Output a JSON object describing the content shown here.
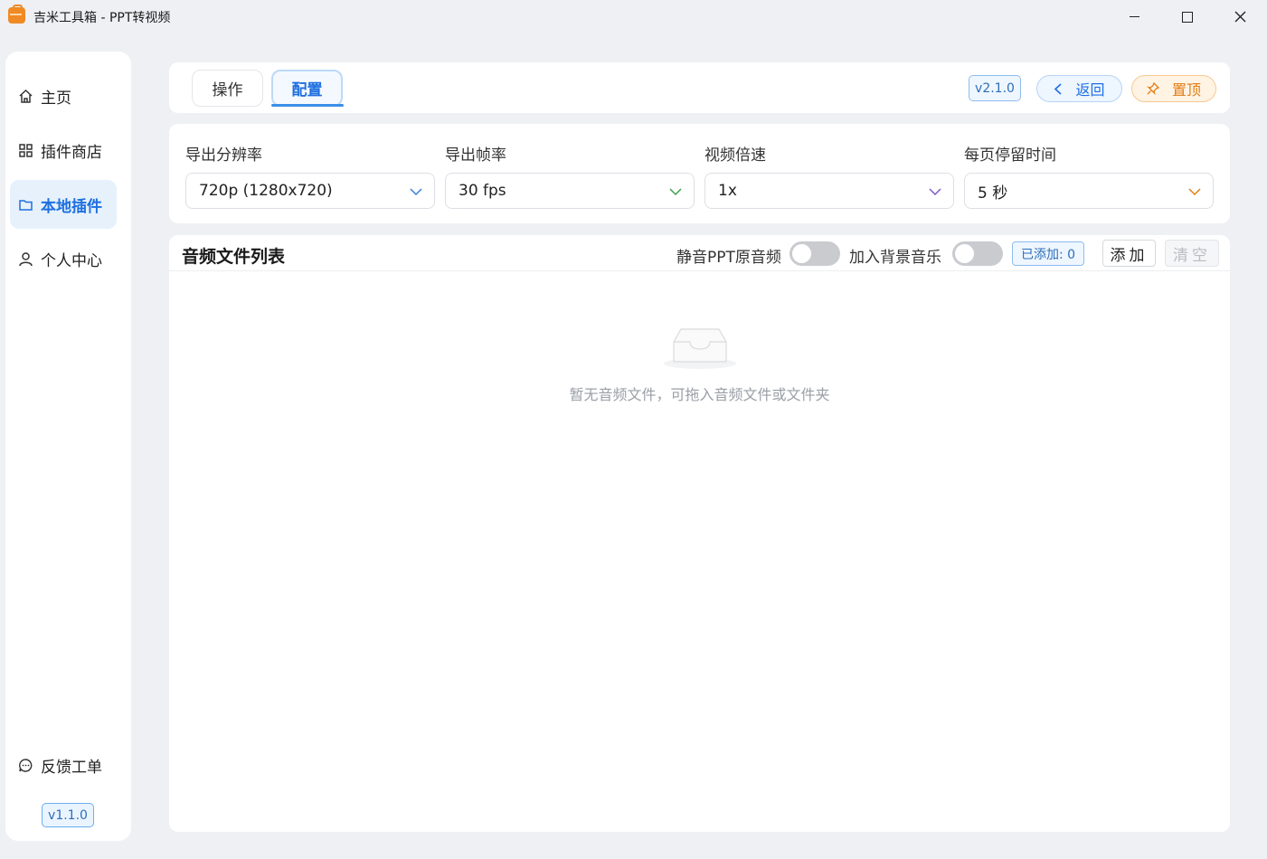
{
  "window": {
    "title": "吉米工具箱 - PPT转视频",
    "minimize_icon": "minimize-icon",
    "maximize_icon": "maximize-icon",
    "close_icon": "close-icon"
  },
  "sidebar": {
    "items": [
      {
        "label": "主页",
        "icon": "home-icon",
        "active": false
      },
      {
        "label": "插件商店",
        "icon": "grid-icon",
        "active": false
      },
      {
        "label": "本地插件",
        "icon": "folder-icon",
        "active": true
      },
      {
        "label": "个人中心",
        "icon": "user-icon",
        "active": false
      }
    ],
    "feedback": {
      "label": "反馈工单",
      "icon": "chat-icon"
    },
    "version": "v1.1.0"
  },
  "header": {
    "tabs": [
      {
        "label": "操作",
        "active": false
      },
      {
        "label": "配置",
        "active": true
      }
    ],
    "version": "v2.1.0",
    "back_label": "返回",
    "pin_label": "置顶"
  },
  "settings": {
    "resolution": {
      "label": "导出分辨率",
      "value": "720p (1280x720)",
      "chevron_color": "#3a7fd6"
    },
    "fps": {
      "label": "导出帧率",
      "value": "30 fps",
      "chevron_color": "#3aa04a"
    },
    "speed": {
      "label": "视频倍速",
      "value": "1x",
      "chevron_color": "#7a5cc9"
    },
    "duration": {
      "label": "每页停留时间",
      "value": "5 秒",
      "chevron_color": "#e17d13"
    }
  },
  "audio_list": {
    "title": "音频文件列表",
    "mute_label": "静音PPT原音频",
    "mute_on": false,
    "bgm_label": "加入背景音乐",
    "bgm_on": false,
    "count_label": "已添加: 0",
    "add_label": "添加",
    "clear_label": "清空",
    "empty_text": "暂无音频文件，可拖入音频文件或文件夹"
  },
  "colors": {
    "accent": "#1e6fe0",
    "pin": "#e17d13",
    "background": "#eef0f3"
  }
}
